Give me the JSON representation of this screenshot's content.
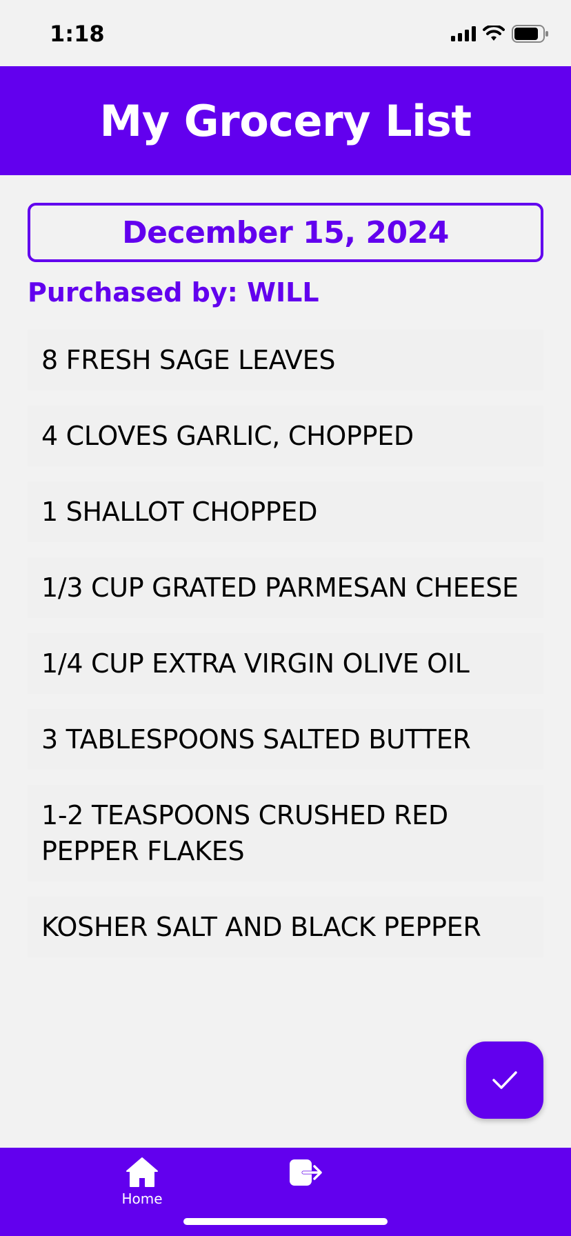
{
  "status_bar": {
    "time": "1:18",
    "icons": [
      "signal-icon",
      "wifi-icon",
      "battery-icon"
    ]
  },
  "header": {
    "title": "My Grocery List"
  },
  "date": "December 15, 2024",
  "purchased_by": "Purchased by: WILL",
  "items": [
    "8 FRESH SAGE LEAVES",
    "4 CLOVES GARLIC, CHOPPED",
    "1 SHALLOT CHOPPED",
    "1/3 CUP GRATED PARMESAN CHEESE",
    "1/4 CUP EXTRA VIRGIN OLIVE OIL",
    "3 TABLESPOONS SALTED BUTTER",
    "1-2 TEASPOONS CRUSHED RED PEPPER FLAKES",
    "KOSHER SALT AND BLACK PEPPER"
  ],
  "fab": {
    "icon": "check-icon"
  },
  "bottom_nav": {
    "home_label": "Home",
    "home_icon": "home-icon",
    "logout_icon": "logout-icon"
  },
  "colors": {
    "primary": "#6200ee",
    "background": "#f2f2f2",
    "item_background": "#f0f0f0"
  }
}
